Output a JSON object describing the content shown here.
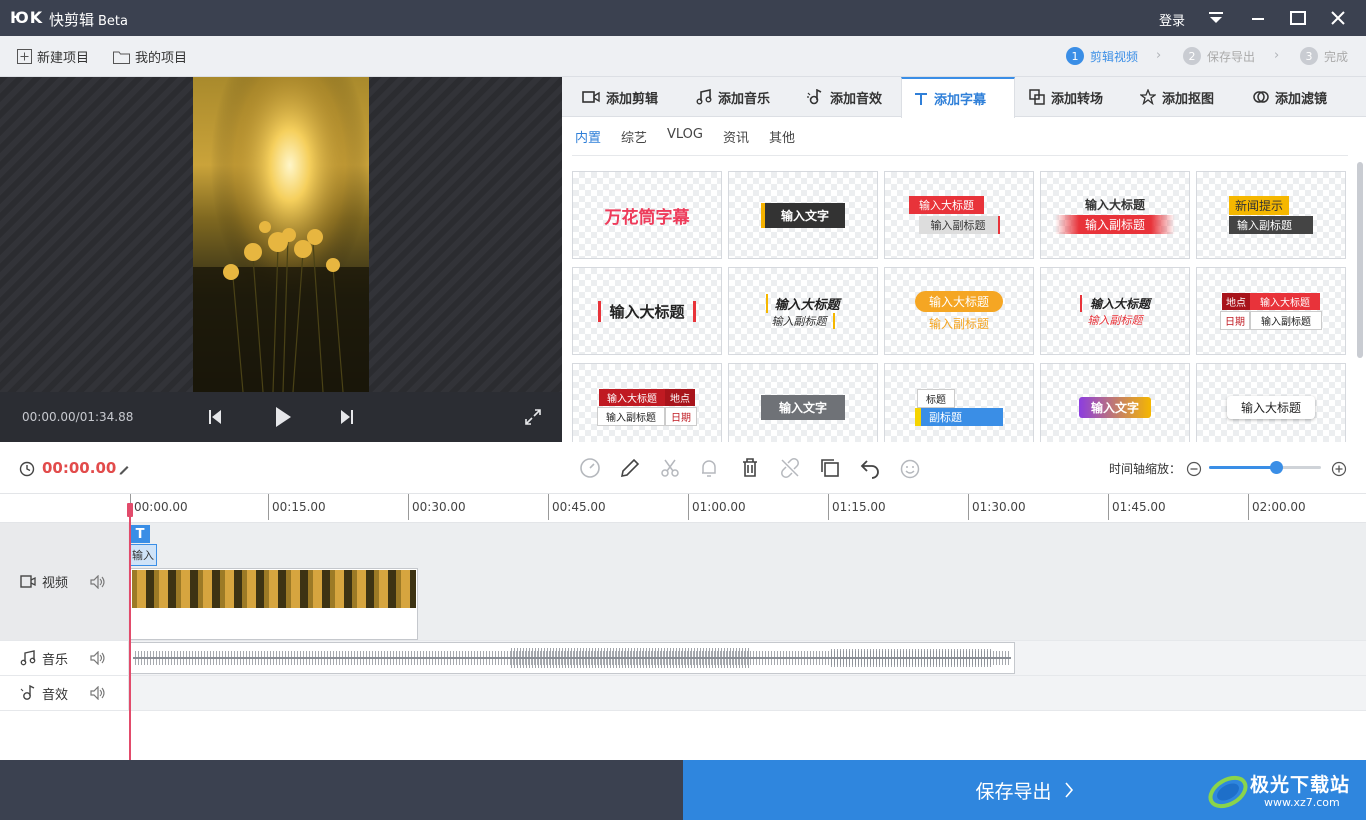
{
  "title_bar": {
    "logo": "ЮK",
    "app_name": "快剪辑",
    "beta": "Beta",
    "login": "登录"
  },
  "menu": {
    "new_project": "新建项目",
    "my_projects": "我的项目"
  },
  "steps": [
    {
      "num": "1",
      "label": "剪辑视频"
    },
    {
      "num": "2",
      "label": "保存导出"
    },
    {
      "num": "3",
      "label": "完成"
    }
  ],
  "player": {
    "time": "00:00.00/01:34.88"
  },
  "tabs": [
    {
      "label": "添加剪辑",
      "icon": "video-camera-icon"
    },
    {
      "label": "添加音乐",
      "icon": "music-note-icon"
    },
    {
      "label": "添加音效",
      "icon": "sound-effect-icon"
    },
    {
      "label": "添加字幕",
      "icon": "text-t-icon"
    },
    {
      "label": "添加转场",
      "icon": "transition-icon"
    },
    {
      "label": "添加抠图",
      "icon": "cutout-star-icon"
    },
    {
      "label": "添加滤镜",
      "icon": "filter-icon"
    }
  ],
  "subtabs": [
    "内置",
    "综艺",
    "VLOG",
    "资讯",
    "其他"
  ],
  "templates": [
    {
      "main": "万花筒字幕"
    },
    {
      "main": "输入文字"
    },
    {
      "main": "输入大标题",
      "sub": "输入副标题"
    },
    {
      "main": "输入大标题",
      "sub": "输入副标题"
    },
    {
      "main": "新闻提示",
      "sub": "输入副标题"
    },
    {
      "main": "输入大标题"
    },
    {
      "main": "输入大标题",
      "sub": "输入副标题"
    },
    {
      "main": "输入大标题",
      "sub": "输入副标题"
    },
    {
      "main": "输入大标题",
      "sub": "输入副标题"
    },
    {
      "main": "输入大标题",
      "sub": "输入副标题",
      "tag1": "地点",
      "tag2": "日期"
    },
    {
      "main": "输入大标题",
      "sub": "输入副标题",
      "tag1": "地点",
      "tag2": "日期"
    },
    {
      "main": "输入文字"
    },
    {
      "main": "标题",
      "sub": "副标题"
    },
    {
      "main": "输入文字"
    },
    {
      "main": "输入大标题"
    }
  ],
  "timeline": {
    "current_time": "00:00.00",
    "zoom_label": "时间轴缩放：",
    "zoom_level": 0.6,
    "ruler": [
      "00:00.00",
      "00:15.00",
      "00:30.00",
      "00:45.00",
      "01:00.00",
      "01:15.00",
      "01:30.00",
      "01:45.00",
      "02:00.00"
    ],
    "subtitle_clip": "输入",
    "tracks": {
      "video": "视频",
      "music": "音乐",
      "sfx": "音效"
    }
  },
  "export": {
    "label": "保存导出"
  },
  "watermark": {
    "cn": "极光下载站",
    "url": "www.xz7.com"
  },
  "colors": {
    "accent": "#2f86de",
    "titlebar": "#3b4150",
    "timecode": "#e24b4b"
  }
}
